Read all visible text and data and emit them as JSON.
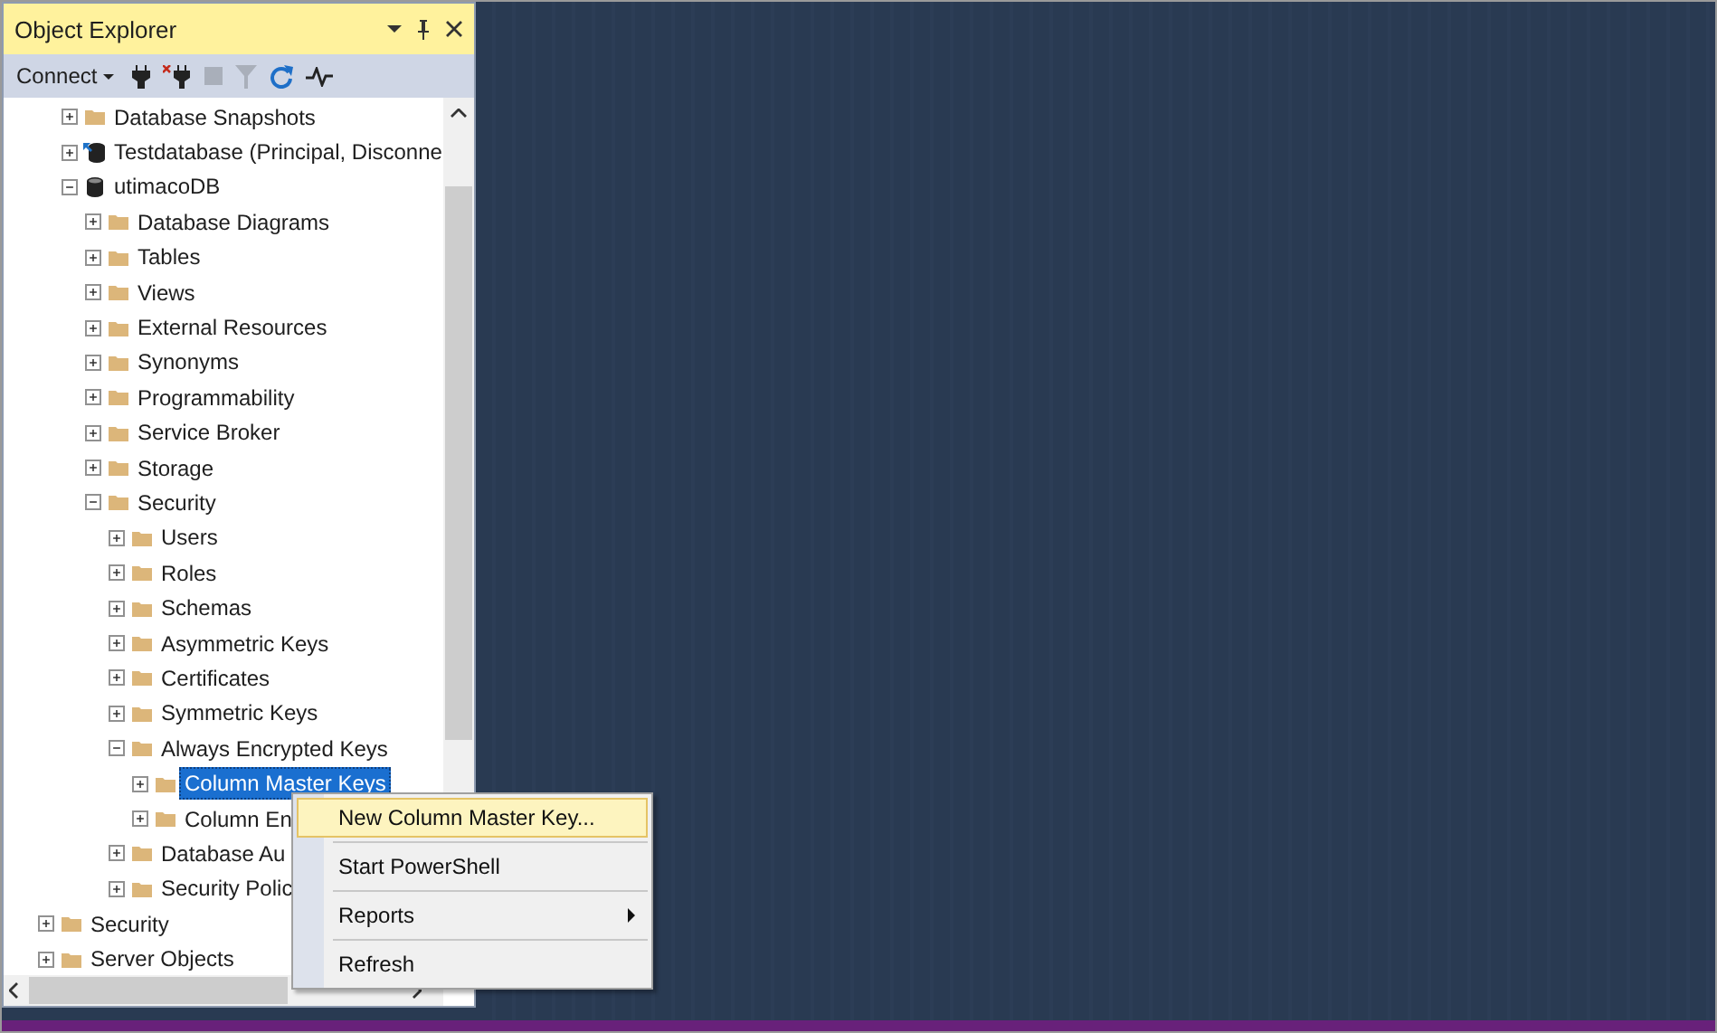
{
  "panel": {
    "title": "Object Explorer",
    "connect": "Connect"
  },
  "tree": [
    {
      "children": [
        {
          "label": "Database Snapshots",
          "kind": "folder",
          "expanded": false,
          "selected": false
        },
        {
          "label": "Testdatabase (Principal, Disconne",
          "kind": "mirror-database",
          "expanded": false,
          "selected": false
        },
        {
          "label": "utimacoDB",
          "kind": "database",
          "expanded": true,
          "selected": false,
          "children": [
            {
              "label": "Database Diagrams",
              "kind": "folder",
              "expanded": false,
              "selected": false
            },
            {
              "label": "Tables",
              "kind": "folder",
              "expanded": false,
              "selected": false
            },
            {
              "label": "Views",
              "kind": "folder",
              "expanded": false,
              "selected": false
            },
            {
              "label": "External Resources",
              "kind": "folder",
              "expanded": false,
              "selected": false
            },
            {
              "label": "Synonyms",
              "kind": "folder",
              "expanded": false,
              "selected": false
            },
            {
              "label": "Programmability",
              "kind": "folder",
              "expanded": false,
              "selected": false
            },
            {
              "label": "Service Broker",
              "kind": "folder",
              "expanded": false,
              "selected": false
            },
            {
              "label": "Storage",
              "kind": "folder",
              "expanded": false,
              "selected": false
            },
            {
              "label": "Security",
              "kind": "folder",
              "expanded": true,
              "selected": false,
              "children": [
                {
                  "label": "Users",
                  "kind": "folder",
                  "expanded": false,
                  "selected": false
                },
                {
                  "label": "Roles",
                  "kind": "folder",
                  "expanded": false,
                  "selected": false
                },
                {
                  "label": "Schemas",
                  "kind": "folder",
                  "expanded": false,
                  "selected": false
                },
                {
                  "label": "Asymmetric Keys",
                  "kind": "folder",
                  "expanded": false,
                  "selected": false
                },
                {
                  "label": "Certificates",
                  "kind": "folder",
                  "expanded": false,
                  "selected": false
                },
                {
                  "label": "Symmetric Keys",
                  "kind": "folder",
                  "expanded": false,
                  "selected": false
                },
                {
                  "label": "Always Encrypted Keys",
                  "kind": "folder",
                  "expanded": true,
                  "selected": false,
                  "children": [
                    {
                      "label": "Column Master Keys",
                      "kind": "folder",
                      "expanded": false,
                      "selected": true
                    },
                    {
                      "label": "Column En",
                      "kind": "folder",
                      "expanded": false,
                      "selected": false
                    }
                  ]
                },
                {
                  "label": "Database Au",
                  "kind": "folder",
                  "expanded": false,
                  "selected": false
                },
                {
                  "label": "Security Polic",
                  "kind": "folder",
                  "expanded": false,
                  "selected": false
                }
              ]
            }
          ]
        }
      ]
    },
    {
      "label": "Security",
      "kind": "folder",
      "expanded": false,
      "selected": false
    },
    {
      "label": "Server Objects",
      "kind": "folder",
      "expanded": false,
      "selected": false
    }
  ],
  "context_menu": [
    {
      "label": "New Column Master Key...",
      "selected": true,
      "submenu": false
    },
    {
      "label": "Start PowerShell",
      "selected": false,
      "submenu": false
    },
    {
      "label": "Reports",
      "selected": false,
      "submenu": true
    },
    {
      "label": "Refresh",
      "selected": false,
      "submenu": false
    }
  ]
}
